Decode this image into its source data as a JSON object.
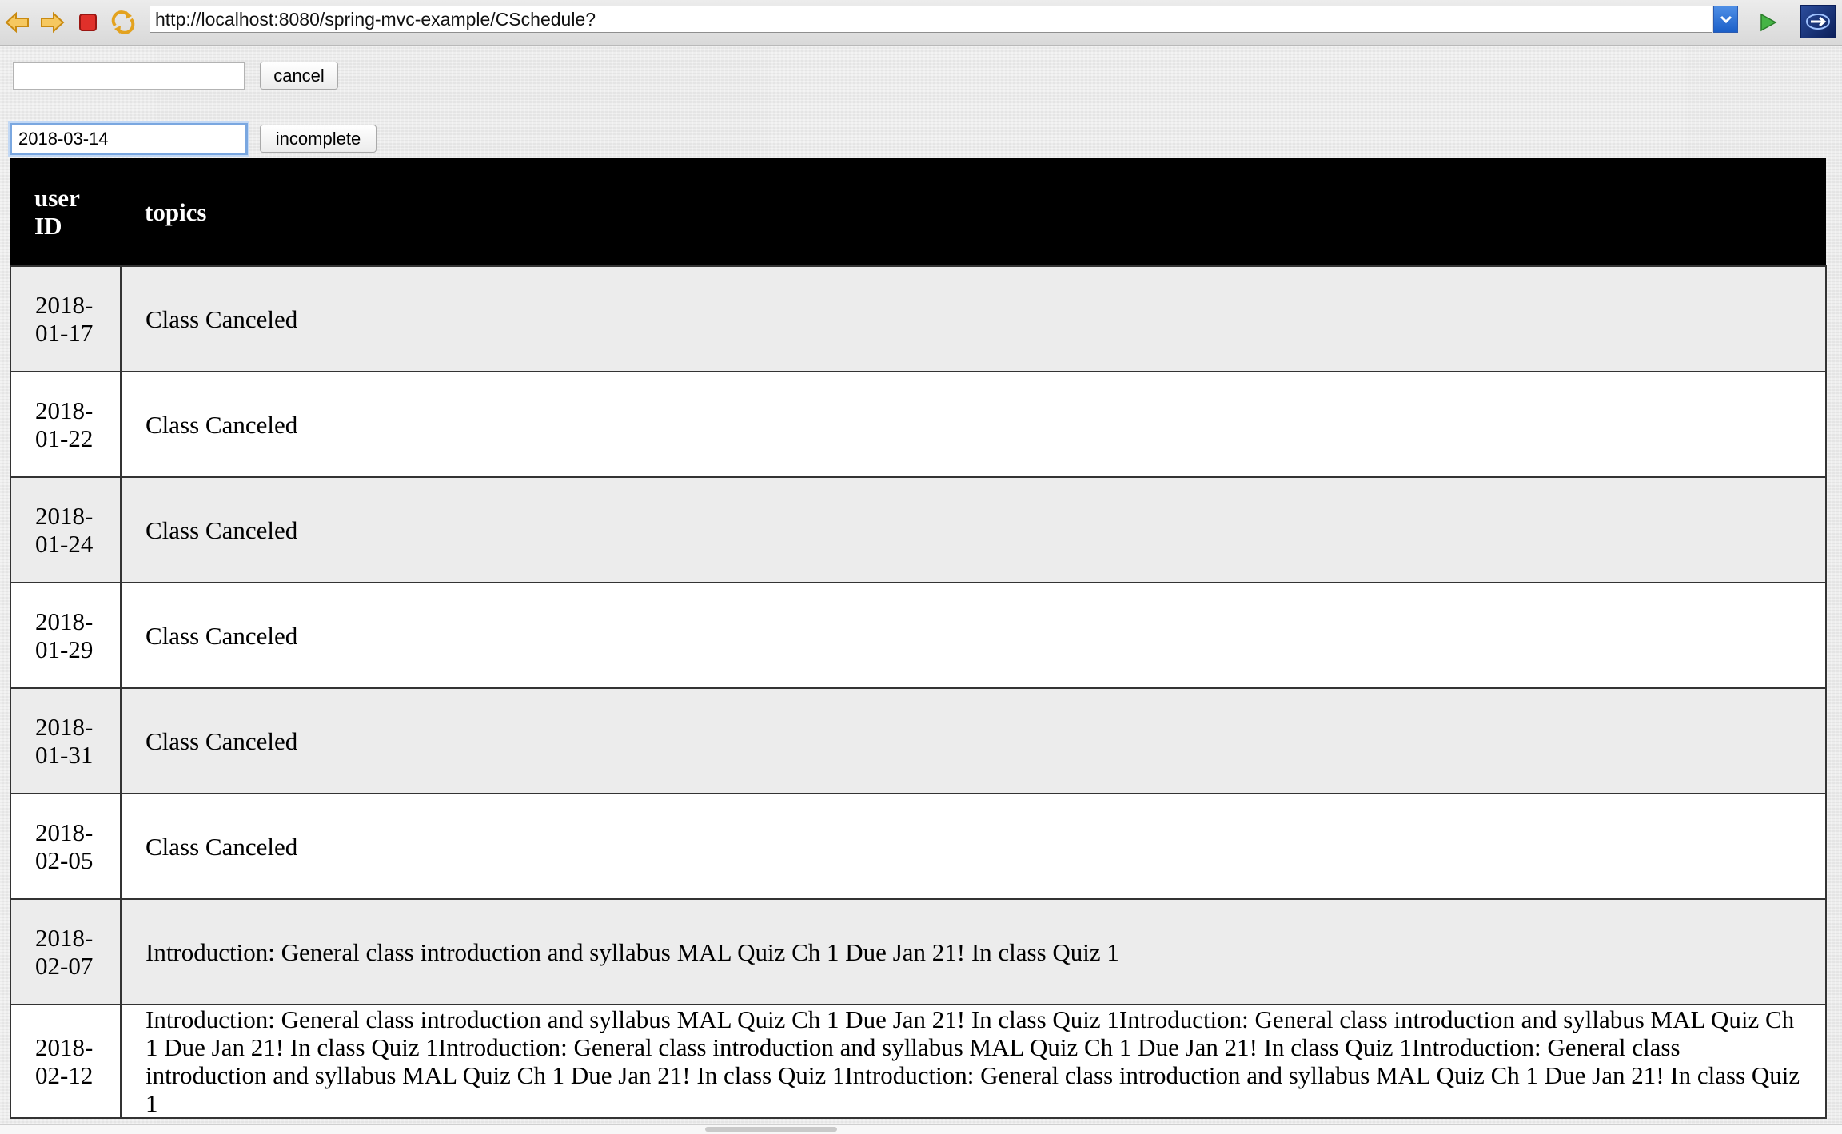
{
  "browser": {
    "url": "http://localhost:8080/spring-mvc-example/CSchedule?",
    "icons": [
      "back-arrow-icon",
      "forward-arrow-icon",
      "stop-icon",
      "reload-icon",
      "dropdown-arrow-icon",
      "go-icon",
      "extension-icon"
    ],
    "colors": {
      "arrow": "#f0a928",
      "stop": "#d42020",
      "go": "#3aa83a",
      "dropdown": "#2a6fd6"
    }
  },
  "form": {
    "cancel_input_value": "",
    "cancel_button": "cancel",
    "date_input_value": "2018-03-14",
    "incomplete_button": "incomplete"
  },
  "table": {
    "headers": [
      "user ID",
      "topics"
    ],
    "rows": [
      {
        "date": "2018-01-17",
        "topics": "Class Canceled"
      },
      {
        "date": "2018-01-22",
        "topics": "Class Canceled"
      },
      {
        "date": "2018-01-24",
        "topics": "Class Canceled"
      },
      {
        "date": "2018-01-29",
        "topics": "Class Canceled"
      },
      {
        "date": "2018-01-31",
        "topics": "Class Canceled"
      },
      {
        "date": "2018-02-05",
        "topics": "Class Canceled"
      },
      {
        "date": "2018-02-07",
        "topics": "Introduction: General class introduction and syllabus MAL Quiz Ch 1 Due Jan 21! In class Quiz 1"
      },
      {
        "date": "2018-02-12",
        "topics": "Introduction: General class introduction and syllabus MAL Quiz Ch 1 Due Jan 21! In class Quiz 1Introduction: General class introduction and syllabus MAL Quiz Ch 1 Due Jan 21! In class Quiz 1Introduction: General class introduction and syllabus MAL Quiz Ch 1 Due Jan 21! In class Quiz 1Introduction: General class introduction and syllabus MAL Quiz Ch 1 Due Jan 21! In class Quiz 1Introduction: General class introduction and syllabus MAL Quiz Ch 1 Due Jan 21! In class Quiz 1"
      }
    ]
  }
}
